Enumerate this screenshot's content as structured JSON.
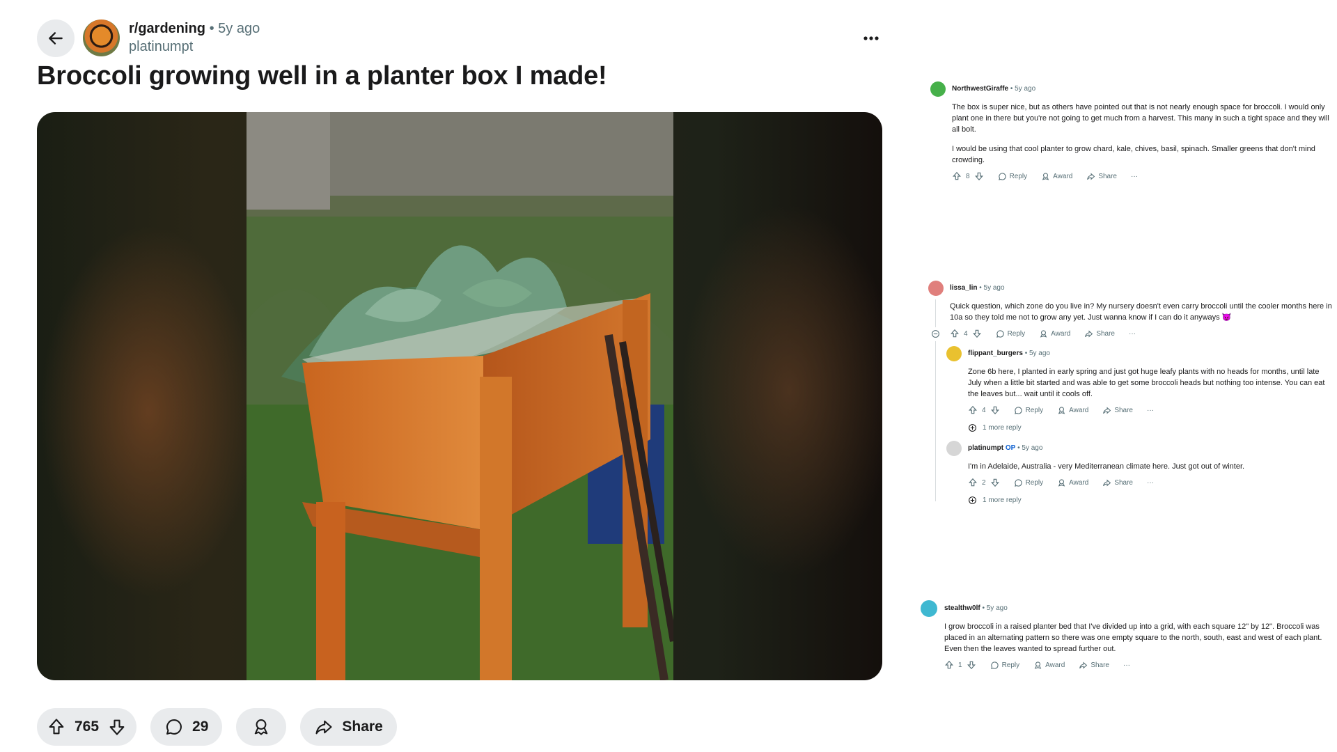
{
  "post": {
    "subreddit": "r/gardening",
    "time_sep": "• 5y ago",
    "author": "platinumpt",
    "title": "Broccoli growing well in a planter box I made!",
    "score": "765",
    "comment_count": "29",
    "share_label": "Share"
  },
  "comments": [
    {
      "author": "NorthwestGiraffe",
      "time": "• 5y ago",
      "paragraphs": [
        "The box is super nice, but as others have pointed out that is not nearly enough space for broccoli. I would only plant one in there but you're not going to get much from a harvest. This many in such a tight space and they will all bolt.",
        "I would be using that cool planter to grow chard, kale, chives, basil, spinach. Smaller greens that don't mind crowding."
      ],
      "score": "8",
      "reply": "Reply",
      "award": "Award",
      "share": "Share",
      "more": "···",
      "avatar_color": "#46b04a"
    },
    {
      "author": "lissa_lin",
      "time": "• 5y ago",
      "paragraphs": [
        "Quick question, which zone do you live in? My nursery doesn't even carry broccoli until the cooler months here in 10a so they told me not to grow any yet. Just wanna know if I can do it anyways 😈"
      ],
      "score": "4",
      "reply": "Reply",
      "award": "Award",
      "share": "Share",
      "more": "···",
      "avatar_color": "#e07f7c"
    },
    {
      "author": "flippant_burgers",
      "time": "• 5y ago",
      "paragraphs": [
        "Zone 6b here, I planted in early spring and just got huge leafy plants with no heads for months, until late July when a little bit started and was able to get some broccoli heads but nothing too intense. You can eat the leaves but... wait until it cools off."
      ],
      "score": "4",
      "reply": "Reply",
      "award": "Award",
      "share": "Share",
      "more": "···",
      "more_replies": "1 more reply",
      "avatar_color": "#e9c12f"
    },
    {
      "author": "platinumpt",
      "op": "OP",
      "time": "• 5y ago",
      "paragraphs": [
        "I'm in Adelaide, Australia - very Mediterranean climate here. Just got out of winter."
      ],
      "score": "2",
      "reply": "Reply",
      "award": "Award",
      "share": "Share",
      "more": "···",
      "more_replies": "1 more reply",
      "avatar_color": "#d6d6d6"
    },
    {
      "author": "stealthw0lf",
      "time": "• 5y ago",
      "paragraphs": [
        "I grow broccoli in a raised planter bed that I've divided up into a grid, with each square 12\" by 12\". Broccoli was placed in an alternating pattern so there was one empty square to the north, south, east and west of each plant. Even then the leaves wanted to spread further out."
      ],
      "score": "1",
      "reply": "Reply",
      "award": "Award",
      "share": "Share",
      "more": "···",
      "avatar_color": "#3fb8d1"
    }
  ]
}
